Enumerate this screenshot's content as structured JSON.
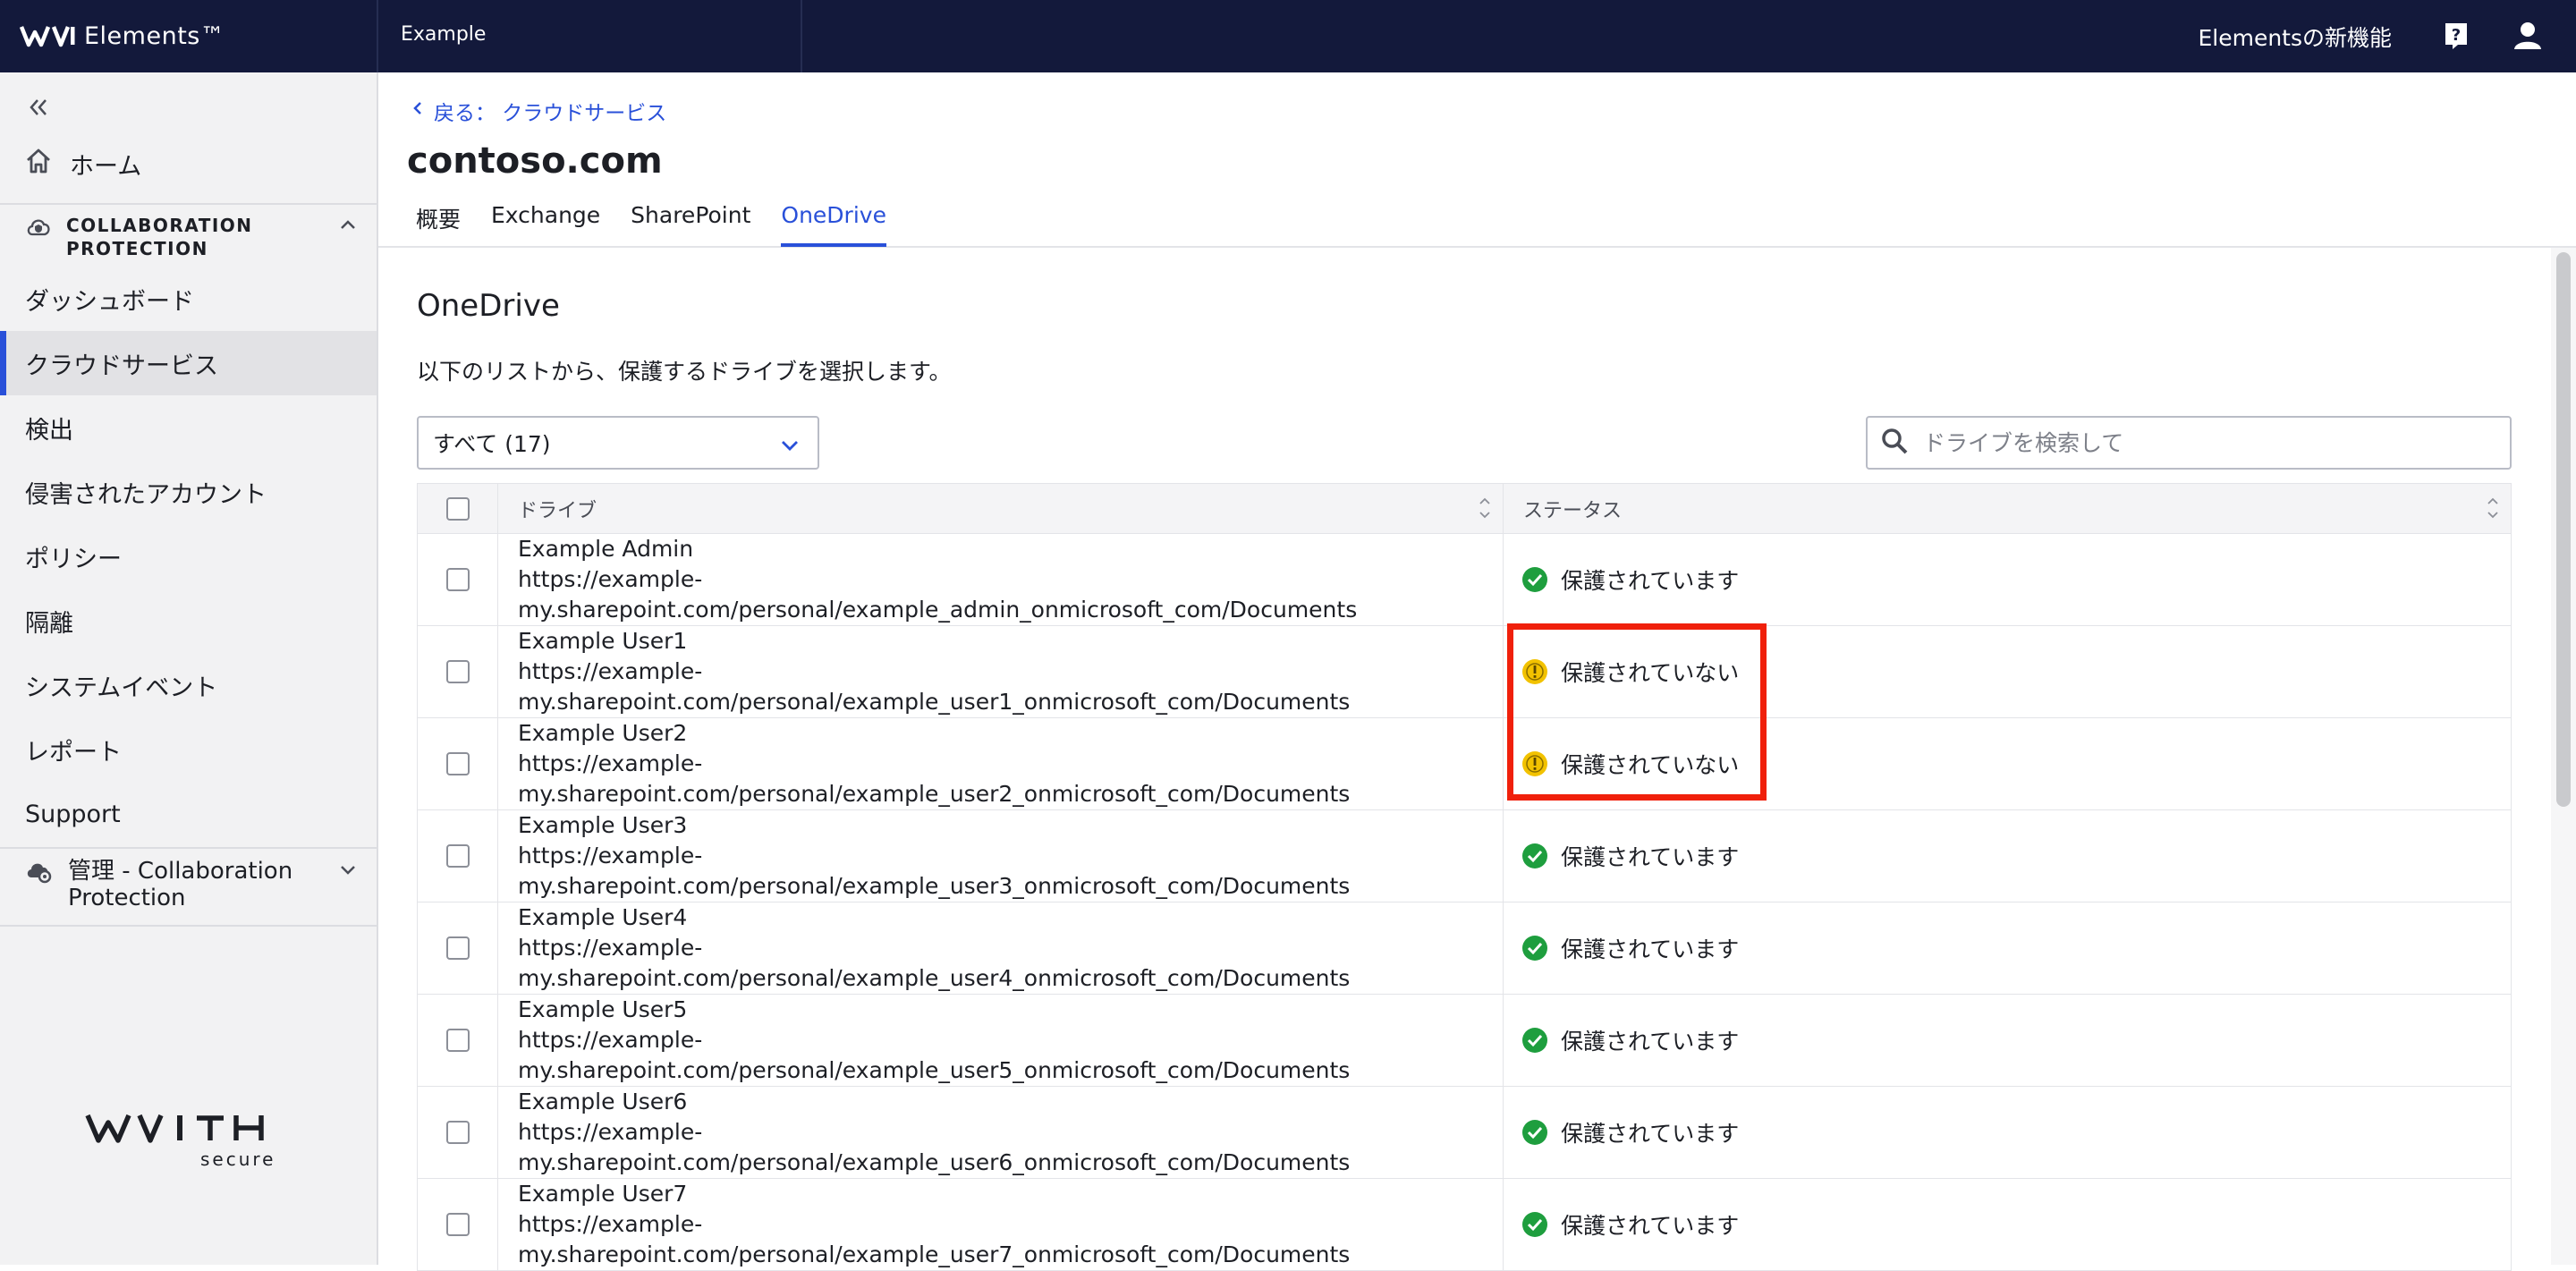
{
  "topbar": {
    "brand": "Elements™",
    "org": "Example",
    "whats_new": "Elementsの新機能"
  },
  "sidebar": {
    "home": "ホーム",
    "section_title": "COLLABORATION PROTECTION",
    "section_title_line1": "COLLABORATION",
    "section_title_line2": "PROTECTION",
    "items": [
      {
        "label": "ダッシュボード"
      },
      {
        "label": "クラウドサービス",
        "active": true
      },
      {
        "label": "検出"
      },
      {
        "label": "侵害されたアカウント"
      },
      {
        "label": "ポリシー"
      },
      {
        "label": "隔離"
      },
      {
        "label": "システムイベント"
      },
      {
        "label": "レポート"
      },
      {
        "label": "Support"
      }
    ],
    "admin_line1": "管理 - Collaboration",
    "admin_line2": "Protection",
    "footer_logo_text": "WITH secure"
  },
  "header": {
    "breadcrumb": "戻る： クラウドサービス",
    "title": "contoso.com",
    "tabs": [
      "概要",
      "Exchange",
      "SharePoint",
      "OneDrive"
    ],
    "active_tab": "OneDrive"
  },
  "content": {
    "title": "OneDrive",
    "description": "以下のリストから、保護するドライブを選択します。",
    "filter_value": "すべて (17)",
    "search_placeholder": "ドライブを検索して"
  },
  "table": {
    "headers": {
      "drive": "ドライブ",
      "status": "ステータス"
    },
    "rows": [
      {
        "name": "Example Admin",
        "url": "https://example-my.sharepoint.com/personal/example_admin_onmicrosoft_com/Documents",
        "status": "保護されています",
        "protected": true
      },
      {
        "name": "Example User1",
        "url": "https://example-my.sharepoint.com/personal/example_user1_onmicrosoft_com/Documents",
        "status": "保護されていない",
        "protected": false
      },
      {
        "name": "Example User2",
        "url": "https://example-my.sharepoint.com/personal/example_user2_onmicrosoft_com/Documents",
        "status": "保護されていない",
        "protected": false
      },
      {
        "name": "Example User3",
        "url": "https://example-my.sharepoint.com/personal/example_user3_onmicrosoft_com/Documents",
        "status": "保護されています",
        "protected": true
      },
      {
        "name": "Example User4",
        "url": "https://example-my.sharepoint.com/personal/example_user4_onmicrosoft_com/Documents",
        "status": "保護されています",
        "protected": true
      },
      {
        "name": "Example User5",
        "url": "https://example-my.sharepoint.com/personal/example_user5_onmicrosoft_com/Documents",
        "status": "保護されています",
        "protected": true
      },
      {
        "name": "Example User6",
        "url": "https://example-my.sharepoint.com/personal/example_user6_onmicrosoft_com/Documents",
        "status": "保護されています",
        "protected": true
      },
      {
        "name": "Example User7",
        "url": "https://example-my.sharepoint.com/personal/example_user7_onmicrosoft_com/Documents",
        "status": "保護されています",
        "protected": true
      }
    ]
  },
  "colors": {
    "topbar": "#13193b",
    "accent": "#2950d9",
    "protected": "#1e9e3e",
    "warning": "#f2c200",
    "highlight": "#f0200b"
  },
  "icons": {
    "protected": "check-circle-icon",
    "unprotected": "warning-circle-icon"
  }
}
